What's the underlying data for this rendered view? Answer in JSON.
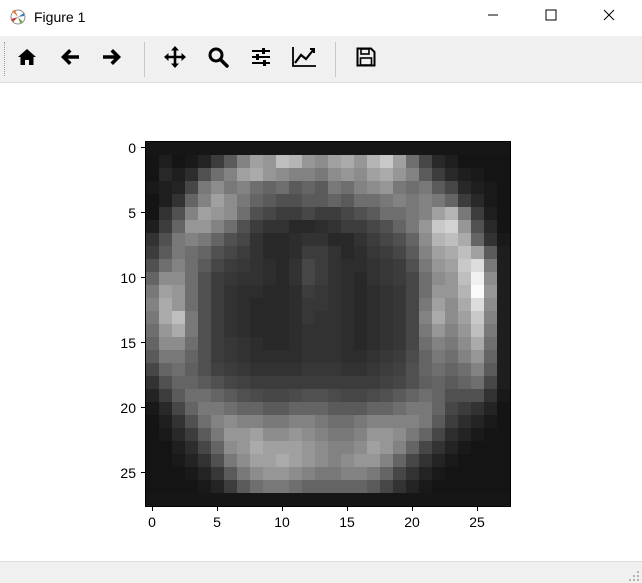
{
  "window": {
    "title": "Figure 1",
    "icon": "matplotlib-icon",
    "controls": {
      "minimize": "minimize-icon",
      "maximize": "maximize-icon",
      "close": "close-icon"
    }
  },
  "toolbar": {
    "buttons": [
      {
        "name": "home-button",
        "icon": "home-icon",
        "tooltip": "Reset original view"
      },
      {
        "name": "back-button",
        "icon": "arrow-left-icon",
        "tooltip": "Back to previous view"
      },
      {
        "name": "forward-button",
        "icon": "arrow-right-icon",
        "tooltip": "Forward to next view"
      },
      {
        "name": "pan-button",
        "icon": "move-icon",
        "tooltip": "Pan axes"
      },
      {
        "name": "zoom-button",
        "icon": "zoom-icon",
        "tooltip": "Zoom to rectangle"
      },
      {
        "name": "subplots-button",
        "icon": "sliders-icon",
        "tooltip": "Configure subplots"
      },
      {
        "name": "edit-axes-button",
        "icon": "line-chart-icon",
        "tooltip": "Edit axis, curve and image parameters"
      },
      {
        "name": "save-button",
        "icon": "save-icon",
        "tooltip": "Save the figure"
      }
    ]
  },
  "status": {
    "text": ""
  },
  "chart_data": {
    "type": "heatmap",
    "colormap": "gray",
    "rows": 28,
    "cols": 28,
    "xlim": [
      -0.5,
      27.5
    ],
    "ylim": [
      27.5,
      -0.5
    ],
    "xticks": [
      "0",
      "5",
      "10",
      "15",
      "20",
      "25"
    ],
    "yticks": [
      "0",
      "5",
      "10",
      "15",
      "20",
      "25"
    ],
    "title": "",
    "xlabel": "",
    "ylabel": "",
    "note": "",
    "values": [
      [
        22,
        22,
        22,
        22,
        22,
        22,
        22,
        22,
        22,
        22,
        22,
        22,
        22,
        22,
        22,
        22,
        22,
        22,
        22,
        22,
        22,
        22,
        22,
        22,
        22,
        22,
        22,
        22
      ],
      [
        20,
        30,
        20,
        25,
        35,
        60,
        90,
        130,
        160,
        150,
        190,
        180,
        150,
        140,
        160,
        170,
        150,
        180,
        200,
        160,
        110,
        70,
        40,
        30,
        20,
        20,
        20,
        20
      ],
      [
        20,
        40,
        30,
        45,
        80,
        110,
        130,
        160,
        170,
        150,
        140,
        130,
        130,
        120,
        140,
        150,
        140,
        160,
        170,
        150,
        130,
        90,
        60,
        40,
        30,
        25,
        20,
        20
      ],
      [
        25,
        30,
        35,
        70,
        120,
        140,
        120,
        130,
        110,
        100,
        110,
        90,
        100,
        90,
        120,
        110,
        130,
        140,
        150,
        120,
        110,
        120,
        90,
        70,
        40,
        30,
        25,
        20
      ],
      [
        20,
        30,
        50,
        100,
        130,
        160,
        140,
        120,
        100,
        90,
        80,
        80,
        90,
        90,
        100,
        90,
        110,
        110,
        120,
        130,
        120,
        130,
        120,
        100,
        60,
        40,
        25,
        20
      ],
      [
        20,
        50,
        80,
        130,
        160,
        150,
        140,
        110,
        80,
        70,
        60,
        60,
        70,
        60,
        60,
        70,
        80,
        90,
        110,
        110,
        120,
        130,
        160,
        180,
        120,
        60,
        30,
        20
      ],
      [
        30,
        60,
        100,
        150,
        150,
        130,
        110,
        80,
        60,
        50,
        50,
        40,
        40,
        45,
        50,
        60,
        60,
        70,
        80,
        100,
        120,
        150,
        200,
        210,
        150,
        80,
        40,
        20
      ],
      [
        50,
        80,
        120,
        130,
        120,
        100,
        80,
        70,
        50,
        40,
        40,
        45,
        50,
        50,
        40,
        40,
        50,
        60,
        70,
        80,
        100,
        140,
        180,
        190,
        170,
        100,
        50,
        25
      ],
      [
        60,
        90,
        120,
        110,
        100,
        80,
        70,
        60,
        50,
        40,
        40,
        45,
        60,
        60,
        50,
        40,
        45,
        55,
        60,
        70,
        90,
        130,
        160,
        170,
        190,
        160,
        90,
        30
      ],
      [
        80,
        110,
        130,
        110,
        90,
        70,
        60,
        55,
        50,
        45,
        40,
        50,
        70,
        60,
        50,
        45,
        45,
        50,
        55,
        60,
        80,
        120,
        150,
        160,
        200,
        220,
        120,
        30
      ],
      [
        100,
        140,
        140,
        110,
        80,
        60,
        55,
        50,
        50,
        45,
        40,
        50,
        70,
        60,
        50,
        45,
        40,
        50,
        55,
        60,
        70,
        110,
        140,
        150,
        190,
        240,
        140,
        30
      ],
      [
        120,
        160,
        150,
        110,
        80,
        60,
        50,
        45,
        45,
        40,
        40,
        45,
        60,
        55,
        50,
        45,
        40,
        45,
        50,
        55,
        70,
        110,
        150,
        150,
        180,
        250,
        150,
        30
      ],
      [
        130,
        170,
        150,
        110,
        80,
        60,
        50,
        45,
        40,
        40,
        40,
        45,
        55,
        55,
        50,
        45,
        40,
        45,
        50,
        55,
        70,
        120,
        160,
        140,
        170,
        220,
        140,
        30
      ],
      [
        120,
        170,
        190,
        120,
        80,
        60,
        50,
        45,
        40,
        40,
        40,
        45,
        55,
        50,
        50,
        45,
        40,
        45,
        50,
        55,
        70,
        130,
        170,
        140,
        160,
        200,
        130,
        30
      ],
      [
        110,
        150,
        170,
        120,
        80,
        60,
        50,
        45,
        40,
        40,
        40,
        45,
        50,
        50,
        50,
        45,
        40,
        45,
        50,
        55,
        70,
        120,
        150,
        130,
        150,
        190,
        120,
        30
      ],
      [
        100,
        140,
        140,
        110,
        80,
        60,
        55,
        50,
        45,
        40,
        40,
        45,
        50,
        50,
        50,
        45,
        40,
        45,
        50,
        55,
        70,
        110,
        130,
        120,
        140,
        170,
        110,
        30
      ],
      [
        90,
        120,
        120,
        100,
        80,
        60,
        55,
        50,
        45,
        45,
        45,
        45,
        50,
        50,
        50,
        45,
        45,
        50,
        55,
        60,
        75,
        100,
        120,
        110,
        130,
        150,
        100,
        30
      ],
      [
        70,
        100,
        110,
        95,
        80,
        65,
        60,
        55,
        50,
        50,
        50,
        50,
        55,
        55,
        55,
        50,
        50,
        55,
        60,
        65,
        80,
        100,
        110,
        100,
        110,
        130,
        90,
        30
      ],
      [
        50,
        80,
        100,
        100,
        90,
        80,
        70,
        65,
        60,
        60,
        60,
        60,
        60,
        60,
        60,
        60,
        60,
        60,
        65,
        70,
        80,
        95,
        100,
        90,
        100,
        110,
        70,
        30
      ],
      [
        35,
        60,
        90,
        110,
        110,
        100,
        90,
        80,
        75,
        70,
        70,
        75,
        80,
        80,
        75,
        70,
        70,
        75,
        80,
        90,
        100,
        110,
        100,
        80,
        80,
        80,
        50,
        25
      ],
      [
        25,
        40,
        70,
        100,
        120,
        120,
        110,
        100,
        100,
        90,
        90,
        100,
        100,
        100,
        90,
        90,
        90,
        100,
        100,
        110,
        120,
        120,
        100,
        70,
        60,
        50,
        35,
        20
      ],
      [
        20,
        30,
        50,
        80,
        110,
        130,
        140,
        130,
        130,
        120,
        120,
        130,
        130,
        120,
        110,
        110,
        120,
        130,
        130,
        130,
        130,
        120,
        90,
        60,
        45,
        35,
        25,
        20
      ],
      [
        20,
        25,
        40,
        60,
        90,
        120,
        150,
        150,
        160,
        140,
        140,
        150,
        140,
        130,
        120,
        120,
        130,
        150,
        150,
        140,
        120,
        100,
        70,
        45,
        35,
        25,
        20,
        20
      ],
      [
        20,
        20,
        30,
        45,
        70,
        100,
        140,
        150,
        170,
        160,
        160,
        160,
        150,
        140,
        130,
        130,
        140,
        160,
        150,
        130,
        100,
        70,
        50,
        35,
        25,
        20,
        20,
        20
      ],
      [
        20,
        20,
        25,
        35,
        50,
        80,
        120,
        140,
        160,
        160,
        170,
        160,
        150,
        140,
        130,
        140,
        150,
        150,
        130,
        100,
        70,
        50,
        35,
        25,
        20,
        20,
        20,
        20
      ],
      [
        20,
        20,
        20,
        25,
        35,
        55,
        90,
        120,
        140,
        150,
        150,
        140,
        130,
        120,
        120,
        130,
        130,
        120,
        100,
        70,
        50,
        35,
        25,
        20,
        20,
        20,
        20,
        20
      ],
      [
        20,
        20,
        20,
        20,
        25,
        35,
        60,
        90,
        110,
        120,
        120,
        110,
        100,
        100,
        100,
        100,
        100,
        90,
        70,
        50,
        35,
        25,
        20,
        20,
        20,
        20,
        20,
        20
      ],
      [
        22,
        22,
        22,
        22,
        22,
        22,
        22,
        22,
        22,
        22,
        22,
        22,
        22,
        22,
        22,
        22,
        22,
        22,
        22,
        22,
        22,
        22,
        22,
        22,
        22,
        22,
        22,
        22
      ]
    ]
  }
}
